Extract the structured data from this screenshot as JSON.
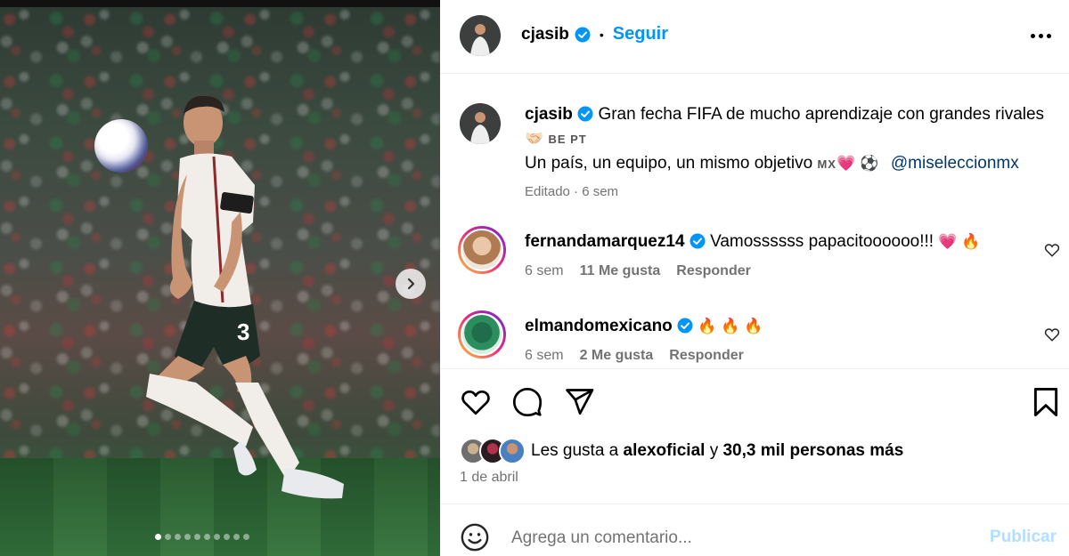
{
  "post": {
    "author": "cjasib",
    "follow_label": "Seguir",
    "separator": "•",
    "caption_line1": "Gran fecha FIFA de mucho aprendizaje con grandes rivales",
    "caption_flags": "BE PT",
    "caption_line2": "Un país, un equipo, un mismo objetivo",
    "caption_flag_mx": "MX",
    "caption_mention": "@miseleccionmx",
    "edited": "Editado · 6 sem",
    "carousel_slide": 1,
    "carousel_total": 10
  },
  "comments": [
    {
      "username": "fernandamarquez14",
      "text": "Vamossssss papacitoooooo!!!",
      "emojis": "💗 🔥",
      "time": "6 sem",
      "likes": "11 Me gusta",
      "reply": "Responder"
    },
    {
      "username": "elmandomexicano",
      "text": "",
      "emojis": "🔥 🔥 🔥",
      "time": "6 sem",
      "likes": "2 Me gusta",
      "reply": "Responder"
    }
  ],
  "likes": {
    "prefix": "Les gusta a",
    "user": "alexoficial",
    "joiner": "y",
    "others": "30,3 mil personas más"
  },
  "date": "1 de abril",
  "composer": {
    "placeholder": "Agrega un comentario...",
    "publish": "Publicar"
  },
  "colors": {
    "accent": "#0095f6",
    "muted": "#737373",
    "mention": "#00376b",
    "publish_disabled": "#b2dffc"
  },
  "icons": [
    "verified-badge-icon",
    "more-options-icon",
    "chevron-right-icon",
    "heart-icon",
    "comment-icon",
    "share-icon",
    "bookmark-icon",
    "emoji-icon"
  ]
}
